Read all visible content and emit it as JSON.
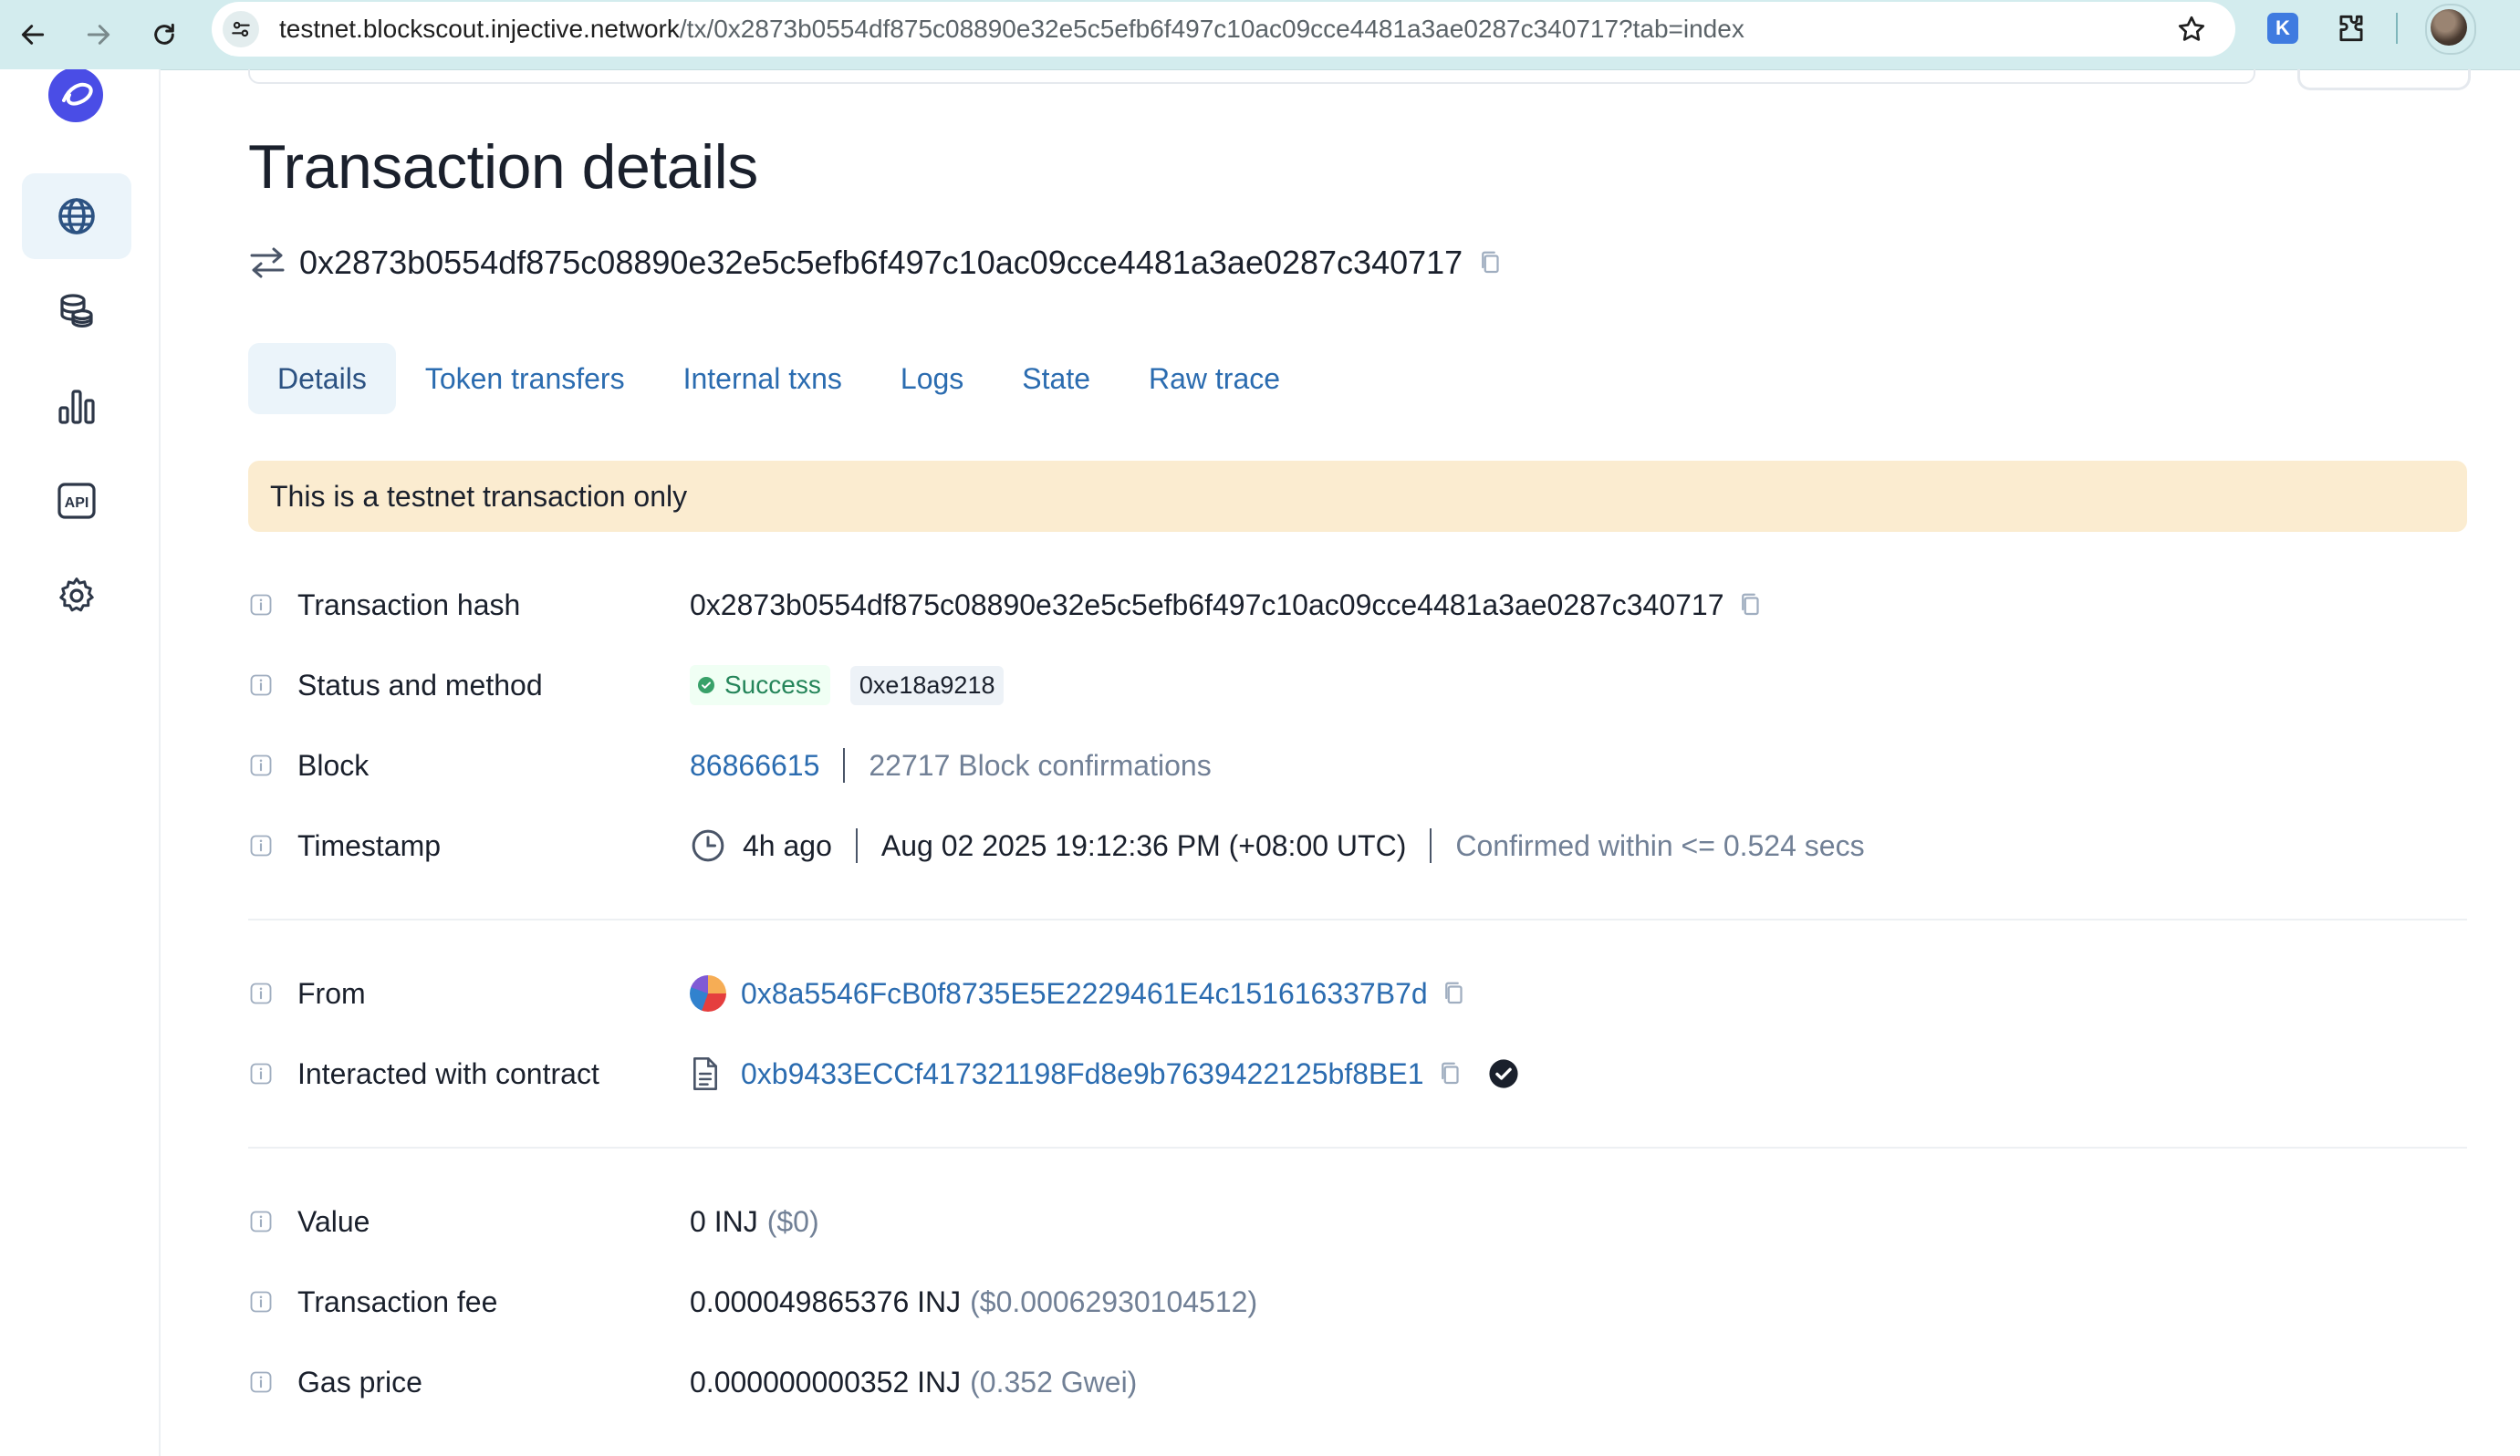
{
  "browser": {
    "url_domain": "testnet.blockscout.injective.network",
    "url_path": "/tx/0x2873b0554df875c08890e32e5c5efb6f497c10ac09cce4481a3ae0287c340717?tab=index",
    "extension_label": "K"
  },
  "sidebar": {
    "items": [
      {
        "icon": "globe-icon"
      },
      {
        "icon": "coins-icon"
      },
      {
        "icon": "bar-chart-icon"
      },
      {
        "icon": "api-icon",
        "label": "API"
      },
      {
        "icon": "gear-icon"
      }
    ]
  },
  "page": {
    "title": "Transaction details",
    "tx_hash": "0x2873b0554df875c08890e32e5c5efb6f497c10ac09cce4481a3ae0287c340717"
  },
  "tabs": [
    "Details",
    "Token transfers",
    "Internal txns",
    "Logs",
    "State",
    "Raw trace"
  ],
  "alert": "This is a testnet transaction only",
  "details": {
    "tx_hash": {
      "label": "Transaction hash",
      "value": "0x2873b0554df875c08890e32e5c5efb6f497c10ac09cce4481a3ae0287c340717"
    },
    "status": {
      "label": "Status and method",
      "status": "Success",
      "method": "0xe18a9218"
    },
    "block": {
      "label": "Block",
      "number": "86866615",
      "confirmations": "22717 Block confirmations"
    },
    "timestamp": {
      "label": "Timestamp",
      "ago": "4h ago",
      "datetime": "Aug 02 2025 19:12:36 PM (+08:00 UTC)",
      "confirmed": "Confirmed within <= 0.524 secs"
    },
    "from": {
      "label": "From",
      "address": "0x8a5546FcB0f8735E5E2229461E4c151616337B7d"
    },
    "contract": {
      "label": "Interacted with contract",
      "address": "0xb9433ECCf417321198Fd8e9b7639422125bf8BE1"
    },
    "value": {
      "label": "Value",
      "amount": "0 INJ",
      "usd": "($0)"
    },
    "fee": {
      "label": "Transaction fee",
      "amount": "0.000049865376 INJ",
      "usd": "($0.00062930104512)"
    },
    "gas_price": {
      "label": "Gas price",
      "amount": "0.000000000352 INJ",
      "gwei": "(0.352 Gwei)"
    }
  },
  "colors": {
    "link": "#2b6cb0",
    "alert_bg": "#fbecd0",
    "success": "#25855a",
    "tab_active_bg": "#ebf4fa"
  }
}
